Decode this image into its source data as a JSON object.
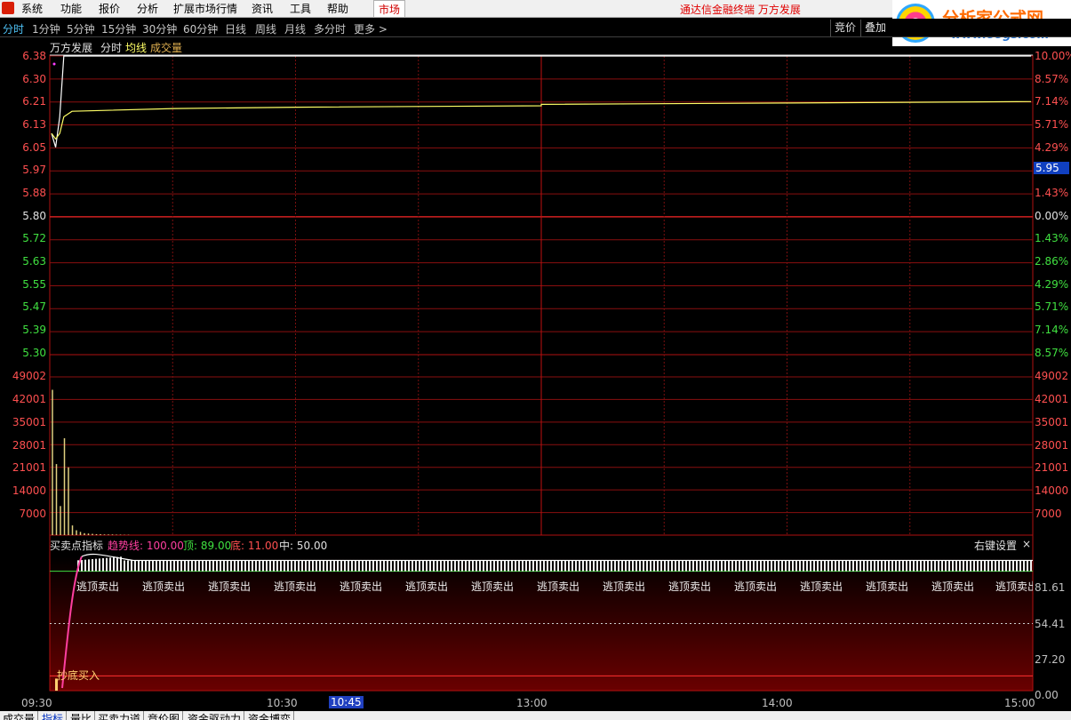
{
  "menu": {
    "items": [
      "系统",
      "功能",
      "报价",
      "分析",
      "扩展市场行情",
      "资讯",
      "工具",
      "帮助"
    ],
    "market": "市场",
    "app_title": "通达信金融终端  万方发展"
  },
  "brand": {
    "title": "分析家公式网",
    "url": "www.88gs.com"
  },
  "periods": [
    "分时",
    "1分钟",
    "5分钟",
    "15分钟",
    "30分钟",
    "60分钟",
    "日线",
    "周线",
    "月线",
    "多分时",
    "更多 >"
  ],
  "period_active": 0,
  "toolbar": {
    "bid": "竞价",
    "overlay": "叠加"
  },
  "price_panel": {
    "stock": "万方发展",
    "view": "分时",
    "avg_label": "均线",
    "vol_label": "成交量",
    "y_labels": [
      "6.38",
      "6.30",
      "6.21",
      "6.13",
      "6.05",
      "5.97",
      "5.88",
      "5.80",
      "5.72",
      "5.63",
      "5.55",
      "5.47",
      "5.39",
      "5.30"
    ],
    "pct_labels": [
      "10.00%",
      "8.57%",
      "7.14%",
      "5.71%",
      "4.29%",
      "2.86%",
      "1.43%",
      "0.00%",
      "1.43%",
      "2.86%",
      "4.29%",
      "5.71%",
      "7.14%",
      "8.57%"
    ],
    "current_price": "5.95"
  },
  "volume_panel": {
    "labels": [
      "49002",
      "42001",
      "35001",
      "28001",
      "21001",
      "14000",
      "7000"
    ],
    "bars": [
      45000,
      22000,
      9000,
      30000,
      21000,
      3000,
      1500,
      1000,
      600,
      500,
      400,
      300,
      300,
      200,
      200,
      200,
      150,
      150,
      100,
      100
    ]
  },
  "indicator_panel": {
    "name": "买卖点指标",
    "trend_label": "趋势线: 100.00",
    "top_label": "顶: 89.00",
    "bottom_label": "底: 11.00",
    "mid_label": "中: 50.00",
    "settings": "右键设置",
    "close": "×",
    "y_labels": [
      "81.61",
      "54.41",
      "27.20",
      "0.00"
    ],
    "signal_sell": "逃顶卖出",
    "signal_buy": "抄底买入"
  },
  "chart_data": {
    "type": "line",
    "title": "万方发展 分时",
    "x_ticks": [
      "09:30",
      "10:30",
      "10:45",
      "13:00",
      "14:00",
      "15:00"
    ],
    "x_cursor": "10:45",
    "price_axis": {
      "min": 5.3,
      "max": 6.38,
      "prev_close": 5.8
    },
    "series": [
      {
        "name": "分时",
        "x": [
          "09:30",
          "09:31",
          "09:32",
          "09:33",
          "09:34",
          "09:35",
          "10:30",
          "11:30",
          "13:00",
          "14:00",
          "15:00"
        ],
        "values": [
          6.1,
          6.05,
          6.16,
          6.38,
          6.38,
          6.38,
          6.38,
          6.38,
          6.38,
          6.38,
          6.38
        ]
      },
      {
        "name": "均线",
        "x": [
          "09:30",
          "09:31",
          "09:32",
          "09:33",
          "09:35",
          "10:00",
          "10:30",
          "11:30",
          "13:00",
          "14:00",
          "15:00"
        ],
        "values": [
          6.1,
          6.08,
          6.1,
          6.16,
          6.18,
          6.19,
          6.195,
          6.2,
          6.205,
          6.21,
          6.215
        ]
      }
    ],
    "volume": {
      "max": 49002
    },
    "indicator": {
      "min": 0,
      "max": 100,
      "levels": [
        89,
        50,
        11
      ]
    }
  },
  "tabs": [
    "成交量",
    "指标",
    "量比",
    "买卖力道",
    "竞价图",
    "资金驱动力",
    "资金博弈"
  ]
}
